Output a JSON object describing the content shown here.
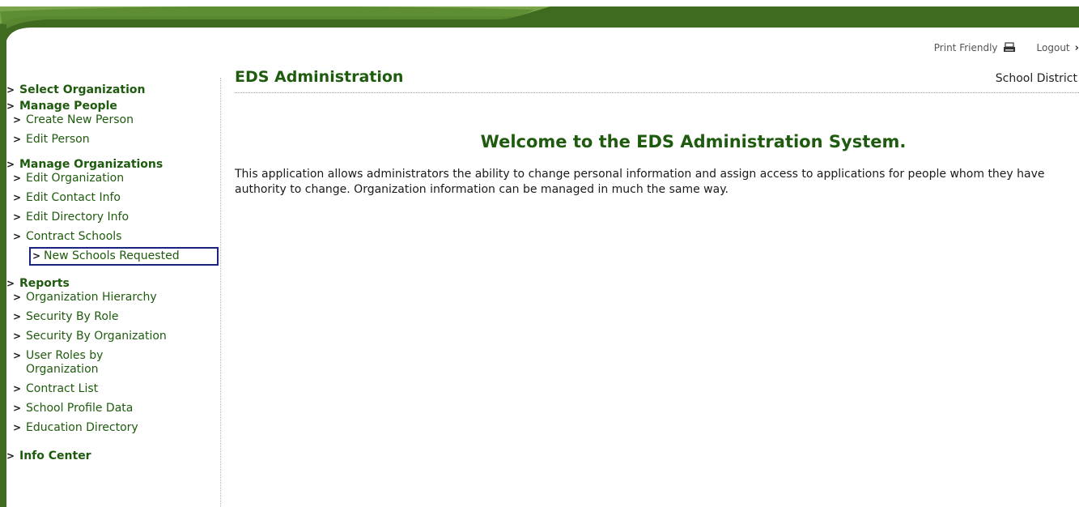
{
  "header": {
    "print_label": "Print Friendly",
    "logout_label": "Logout",
    "logout_glyph": "›",
    "accent_color": "#3e6b1f"
  },
  "sidebar": {
    "select_org": "Select Organization",
    "manage_people": {
      "label": "Manage People",
      "items": [
        "Create New Person",
        "Edit Person"
      ]
    },
    "manage_orgs": {
      "label": "Manage Organizations",
      "items": [
        "Edit Organization",
        "Edit Contact Info",
        "Edit Directory Info",
        "Contract Schools",
        "New Schools Requested"
      ]
    },
    "reports": {
      "label": "Reports",
      "items": [
        "Organization Hierarchy",
        "Security By Role",
        "Security By Organization",
        "User Roles by Organization",
        "Contract List",
        "School Profile Data",
        "Education Directory"
      ]
    },
    "info_center": "Info Center",
    "arrow": ">"
  },
  "main": {
    "title": "EDS Administration",
    "district": "School District",
    "welcome": "Welcome to the EDS Administration System.",
    "description": "This application allows administrators the ability to change personal information and assign access to applications for people whom they have authority to change. Organization information can be managed in much the same way."
  }
}
